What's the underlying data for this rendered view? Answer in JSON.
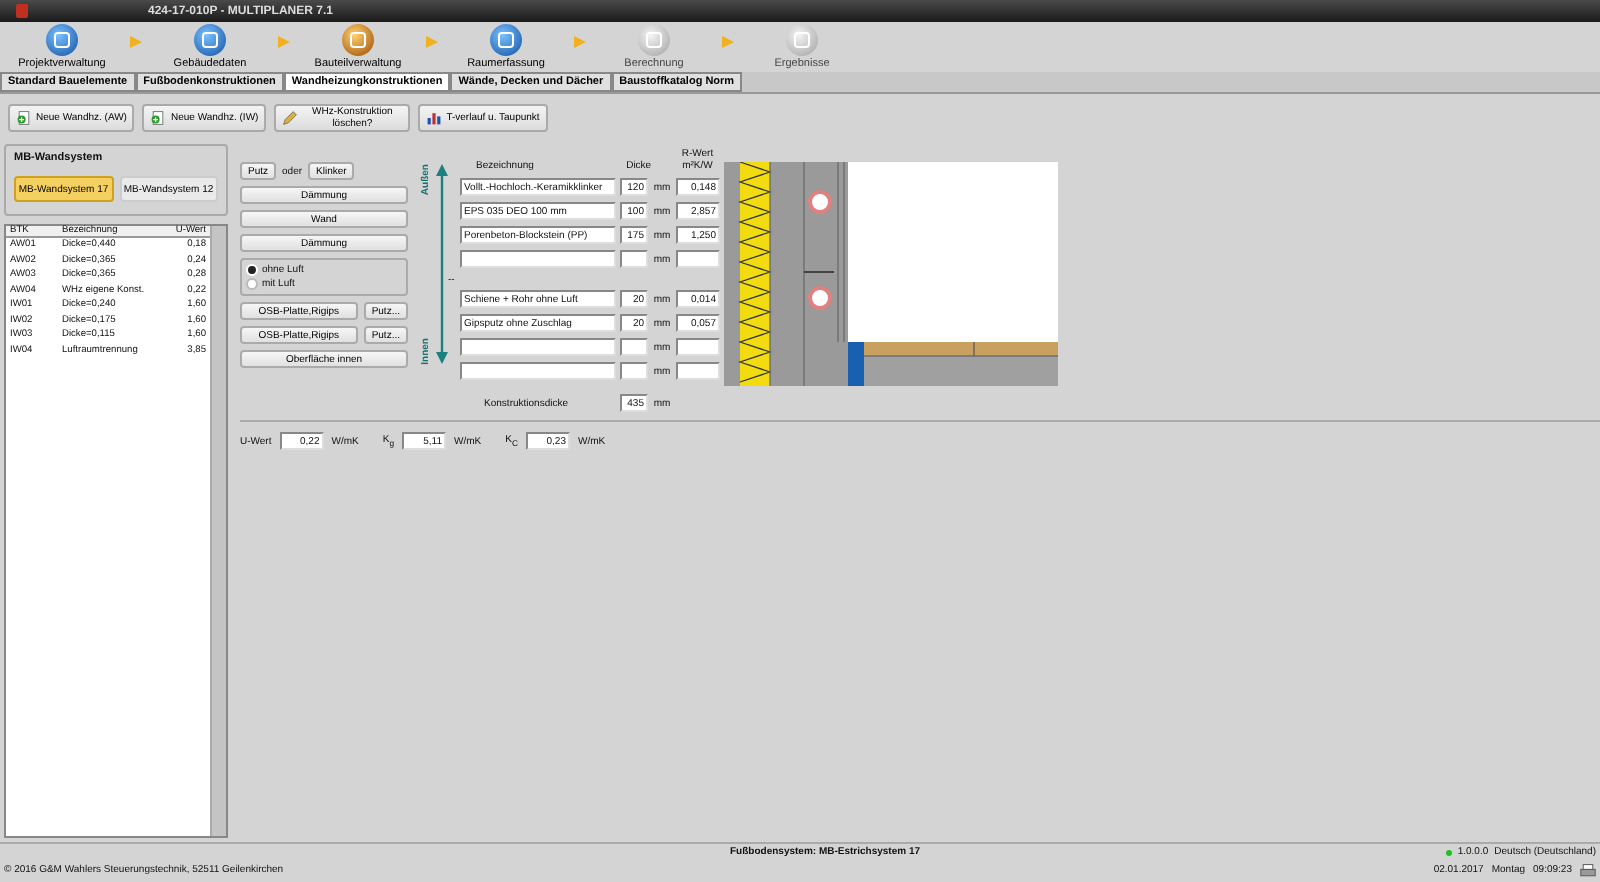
{
  "window": {
    "title": "424-17-010P - MULTIPLANER 7.1"
  },
  "steps": [
    {
      "label": "Projektverwaltung",
      "selected": false,
      "disabled": false
    },
    {
      "label": "Gebäudedaten",
      "selected": false,
      "disabled": false
    },
    {
      "label": "Bauteilverwaltung",
      "selected": true,
      "disabled": false
    },
    {
      "label": "Raumerfassung",
      "selected": false,
      "disabled": false
    },
    {
      "label": "Berechnung",
      "selected": false,
      "disabled": true
    },
    {
      "label": "Ergebnisse",
      "selected": false,
      "disabled": true
    }
  ],
  "tabs": [
    {
      "label": "Standard Bauelemente",
      "selected": false
    },
    {
      "label": "Fußbodenkonstruktionen",
      "selected": false
    },
    {
      "label": "Wandheizungkonstruktionen",
      "selected": true
    },
    {
      "label": "Wände, Decken und Dächer",
      "selected": false
    },
    {
      "label": "Baustoffkatalog Norm",
      "selected": false
    }
  ],
  "toolbar": [
    {
      "label": "Neue Wandhz. (AW)",
      "kind": "add"
    },
    {
      "label": "Neue Wandhz. (IW)",
      "kind": "add"
    },
    {
      "label": "WHz-Konstruktion löschen?",
      "kind": "delete"
    },
    {
      "label": "T-verlauf u. Taupunkt",
      "kind": "chart"
    }
  ],
  "system_group": {
    "title": "MB-Wandsystem",
    "options": [
      {
        "label": "MB-Wandsystem 17",
        "selected": true
      },
      {
        "label": "MB-Wandsystem 12",
        "selected": false
      }
    ]
  },
  "table": {
    "columns": [
      "BTK",
      "Bezeichnung",
      "U-Wert"
    ],
    "rows": [
      [
        "AW01",
        "Dicke=0,440",
        "0,18"
      ],
      [
        "AW02",
        "Dicke=0,365",
        "0,24"
      ],
      [
        "AW03",
        "Dicke=0,365",
        "0,28"
      ],
      [
        "AW04",
        "WHz eigene Konst.",
        "0,22"
      ],
      [
        "IW01",
        "Dicke=0,240",
        "1,60"
      ],
      [
        "IW02",
        "Dicke=0,175",
        "1,60"
      ],
      [
        "IW03",
        "Dicke=0,115",
        "1,60"
      ],
      [
        "IW04",
        "Luftraumtrennung",
        "3,85"
      ]
    ]
  },
  "layer_buttons": {
    "putz": "Putz",
    "oder": "oder",
    "klinker": "Klinker",
    "daemmung_outer": "Dämmung",
    "wand": "Wand",
    "daemmung_inner": "Dämmung",
    "air_options": [
      {
        "label": "ohne Luft",
        "selected": true
      },
      {
        "label": "mit Luft",
        "selected": false
      }
    ],
    "board_rows": [
      {
        "label": "OSB-Platte,Rigips",
        "extra": "Putz..."
      },
      {
        "label": "OSB-Platte,Rigips",
        "extra": "Putz..."
      }
    ],
    "surface": "Oberfläche innen"
  },
  "direction": {
    "outside": "Außen",
    "inside": "Innen"
  },
  "layers": {
    "columns": [
      "Bezeichnung",
      "Dicke",
      "R-Wert",
      "m²K/W"
    ],
    "rows": [
      {
        "name": "Vollt.-Hochloch.-Keramikklinker",
        "thickness": "120",
        "unit": "mm",
        "r": "0,148"
      },
      {
        "name": "EPS 035 DEO 100 mm",
        "thickness": "100",
        "unit": "mm",
        "r": "2,857"
      },
      {
        "name": "Porenbeton-Blockstein (PP)",
        "thickness": "175",
        "unit": "mm",
        "r": "1,250"
      },
      {
        "unit": "mm"
      },
      {
        "kind": "divider",
        "label": "--"
      },
      {
        "name": "Schiene + Rohr ohne Luft",
        "thickness": "20",
        "unit": "mm",
        "r": "0,014"
      },
      {
        "name": "Gipsputz ohne Zuschlag",
        "thickness": "20",
        "unit": "mm",
        "r": "0,057"
      },
      {
        "unit": "mm"
      },
      {
        "unit": "mm"
      }
    ],
    "total_label": "Konstruktionsdicke",
    "total": "435",
    "total_unit": "mm"
  },
  "results": [
    {
      "label": "U-Wert",
      "value": "0,22",
      "unit": "W/mK"
    },
    {
      "label": "K$_{g}$",
      "value": "5,11",
      "unit": "W/mK"
    },
    {
      "label": "K$_{C}$",
      "value": "0,23",
      "unit": "W/mK"
    }
  ],
  "status_bar": {
    "system": "Fußbodensystem: MB-Estrichsystem 17",
    "version": "1.0.0.0",
    "language": "Deutsch (Deutschland)",
    "copyright": "© 2016 G&M Wahlers Steuerungstechnik, 52511 Geilenkirchen",
    "date": "02.01.2017",
    "weekday": "Montag",
    "time": "09:09:23"
  }
}
